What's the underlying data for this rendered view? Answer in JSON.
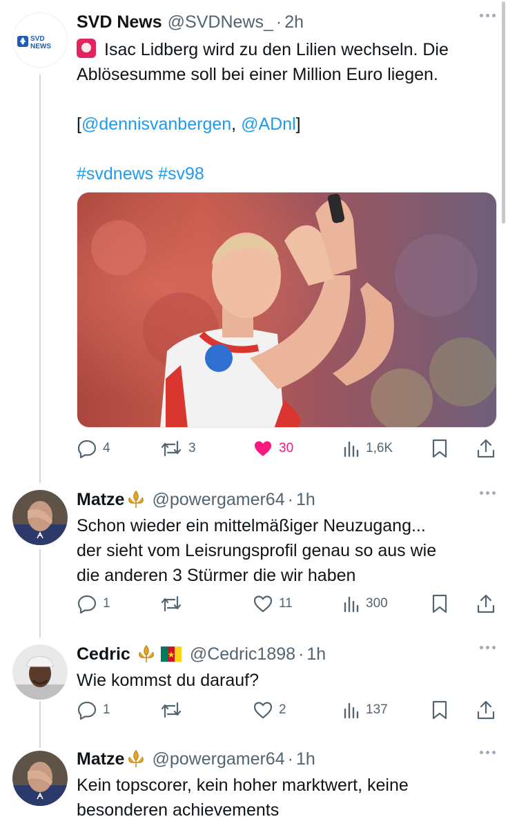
{
  "post": {
    "name": "SVD News",
    "handle": "@SVDNews_",
    "dot": "·",
    "time": "2h",
    "avatar_text_line1": "SVD",
    "avatar_text_line2": "NEWS",
    "text_line1": "Isac Lidberg wird zu den Lilien wechseln. Die",
    "text_line2": "Ablösesumme soll bei einer Million Euro liegen.",
    "sources_open": "[",
    "source1": "@dennisvanbergen",
    "sources_sep": ", ",
    "source2": "@ADnl",
    "sources_close": "]",
    "hashtag1": "#svdnews",
    "hashtag2": "#sv98",
    "replies": "4",
    "reposts": "3",
    "likes": "30",
    "views": "1,6K",
    "badge_icon": "rotating-light-emoji",
    "photo_icon": "player-applauding-photo"
  },
  "replies": [
    {
      "name": "Matze",
      "handle": "@powergamer64",
      "dot": "·",
      "time": "1h",
      "line1": "Schon wieder ein mittelmäßiger Neuzugang...",
      "line2": "der sieht vom Leisrungsprofil genau so aus wie",
      "line3": "die anderen 3 Stürmer die wir haben",
      "replies": "1",
      "reposts": "",
      "likes": "11",
      "views": "300"
    },
    {
      "name": "Cedric",
      "handle": "@Cedric1898",
      "dot": "·",
      "time": "1h",
      "line1": "Wie kommst du darauf?",
      "replies": "1",
      "reposts": "",
      "likes": "2",
      "views": "137"
    },
    {
      "name": "Matze",
      "handle": "@powergamer64",
      "dot": "·",
      "time": "1h",
      "line1": "Kein topscorer, kein hoher marktwert, keine",
      "line2": "besonderen achievements"
    }
  ],
  "colors": {
    "link": "#1d9bf0",
    "like": "#f91880",
    "muted": "#536471",
    "lily_blue": "#1d5cb8"
  }
}
